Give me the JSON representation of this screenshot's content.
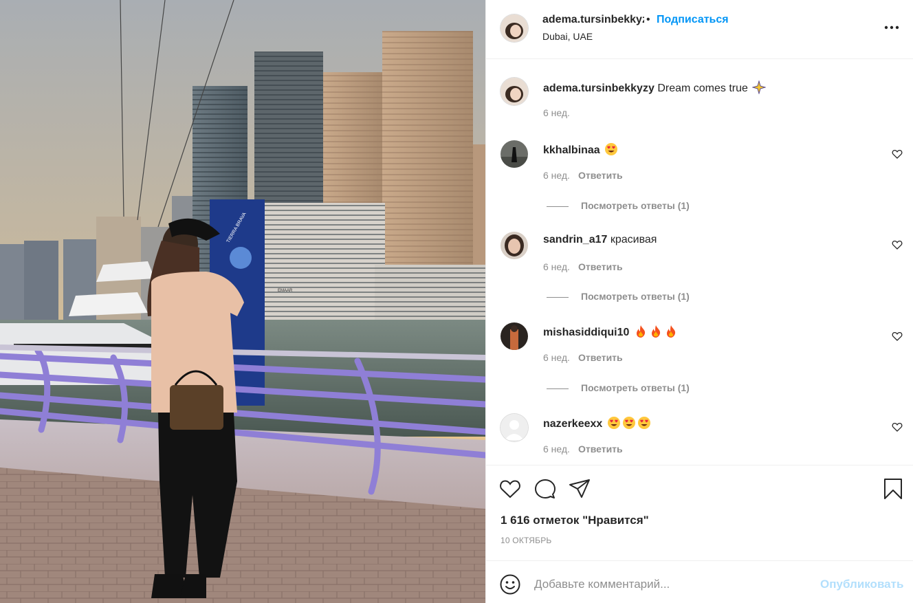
{
  "post": {
    "author": "adema.tursinbekkyzy",
    "follow_label": "Подписаться",
    "separator": "•",
    "location": "Dubai, UAE",
    "caption": "Dream comes true",
    "caption_time": "6 нед.",
    "likes": "1 616 отметок \"Нравится\"",
    "date": "10 ОКТЯБРЬ",
    "photo_signs": {
      "banner": "TIERRA BRAVA",
      "building": "EMAAR"
    }
  },
  "comments": [
    {
      "user": "kkhalbinaa",
      "text": "",
      "emoji": [
        "heart-eyes"
      ],
      "time": "6 нед.",
      "reply_label": "Ответить",
      "replies_label": "Посмотреть ответы (1)"
    },
    {
      "user": "sandrin_a17",
      "text": "красивая",
      "emoji": [],
      "time": "6 нед.",
      "reply_label": "Ответить",
      "replies_label": "Посмотреть ответы (1)"
    },
    {
      "user": "mishasiddiqui10",
      "text": "",
      "emoji": [
        "fire",
        "fire",
        "fire"
      ],
      "time": "6 нед.",
      "reply_label": "Ответить",
      "replies_label": "Посмотреть ответы (1)"
    },
    {
      "user": "nazerkeexx",
      "text": "",
      "emoji": [
        "heart-eyes",
        "heart-eyes",
        "heart-eyes"
      ],
      "time": "6 нед.",
      "reply_label": "Ответить"
    }
  ],
  "add_comment": {
    "placeholder": "Добавьте комментарий...",
    "publish_label": "Опубликовать"
  },
  "colors": {
    "link_blue": "#0095f6",
    "publish_disabled": "#b2dffc",
    "muted": "#8e8e8e",
    "text": "#262626",
    "railing_purple": "#8f7fd6"
  },
  "icons": [
    "more-icon",
    "heart-icon",
    "comment-icon",
    "share-icon",
    "bookmark-icon",
    "smile-icon",
    "sparkle-emoji",
    "heart-eyes-emoji",
    "fire-emoji"
  ]
}
